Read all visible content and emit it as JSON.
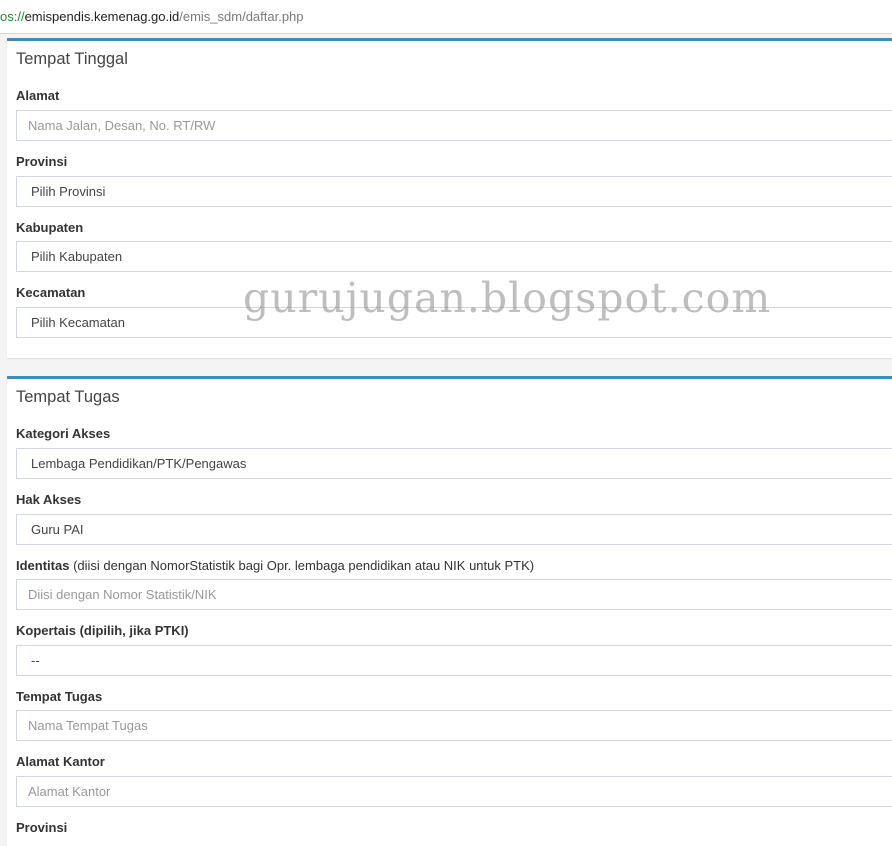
{
  "browser": {
    "url_scheme": "os://",
    "url_host": "emispendis.kemenag.go.id",
    "url_path": "/emis_sdm/daftar.php"
  },
  "tempat_tinggal": {
    "title": "Tempat Tinggal",
    "alamat": {
      "label": "Alamat",
      "placeholder": "Nama Jalan, Desan, No. RT/RW"
    },
    "provinsi": {
      "label": "Provinsi",
      "value": "Pilih Provinsi"
    },
    "kabupaten": {
      "label": "Kabupaten",
      "value": "Pilih Kabupaten"
    },
    "kecamatan": {
      "label": "Kecamatan",
      "value": "Pilih Kecamatan"
    }
  },
  "tempat_tugas": {
    "title": "Tempat Tugas",
    "kategori_akses": {
      "label": "Kategori Akses",
      "value": "Lembaga Pendidikan/PTK/Pengawas"
    },
    "hak_akses": {
      "label": "Hak Akses",
      "value": "Guru PAI"
    },
    "identitas": {
      "label": "Identitas",
      "note": " (diisi dengan NomorStatistik bagi Opr. lembaga pendidikan atau NIK untuk PTK)",
      "placeholder": "Diisi dengan Nomor Statistik/NIK"
    },
    "kopertais": {
      "label": "Kopertais (dipilih, jika PTKI)",
      "value": "--"
    },
    "tempat_tugas": {
      "label": "Tempat Tugas",
      "placeholder": "Nama Tempat Tugas"
    },
    "alamat_kantor": {
      "label": "Alamat Kantor",
      "placeholder": "Alamat Kantor"
    },
    "provinsi": {
      "label": "Provinsi"
    }
  },
  "watermark": "gurujugan.blogspot.com"
}
